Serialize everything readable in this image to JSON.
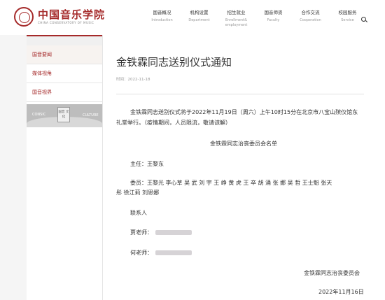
{
  "logo": {
    "name_cn": "中国音乐学院",
    "name_en": "CHINA CONSERVATORY OF MUSIC"
  },
  "nav": [
    {
      "cn": "国音概况",
      "en": "Introduction"
    },
    {
      "cn": "机构设置",
      "en": "Department"
    },
    {
      "cn": "招生就业",
      "en": "Enrollment& employment"
    },
    {
      "cn": "国音师资",
      "en": "Faculty"
    },
    {
      "cn": "合作交流",
      "en": "Cooperation"
    },
    {
      "cn": "校园服务",
      "en": "Service"
    }
  ],
  "search_icon": "search-icon",
  "sidebar": {
    "items": [
      {
        "label": "国音要闻"
      },
      {
        "label": "媒体视角"
      },
      {
        "label": "国音视界"
      }
    ],
    "banner": {
      "left": "CONSIC",
      "right": "CULTURE",
      "stamp": "国音 文化"
    }
  },
  "article": {
    "title": "金铁霖同志送别仪式通知",
    "date": "时间：2022-11-18",
    "para1_line1": "金铁霖同志送别仪式将于2022年11月19日（周六）上午10时15分在北京市八宝山殡仪馆东",
    "para1_line2": "礼堂举行。（疫情期间，人员限流，敬请谅解）",
    "list_title": "金铁霖同志治丧委员会名单",
    "chair": "主任：王黎东",
    "members_line1": "委员：王黎光  李心草  吴  武  刘  宇  王  峥  黄  虎  王  卒  胡  涌  张  娜  吴  哲  王士魁  张天",
    "members_line2": "彤  徐江莉  刘思娜",
    "contact": "联系人",
    "contact1": "贾老师：",
    "contact2": "何老师：",
    "sign": "金铁霖同志治丧委员会",
    "sign_date": "2022年11月16日"
  }
}
